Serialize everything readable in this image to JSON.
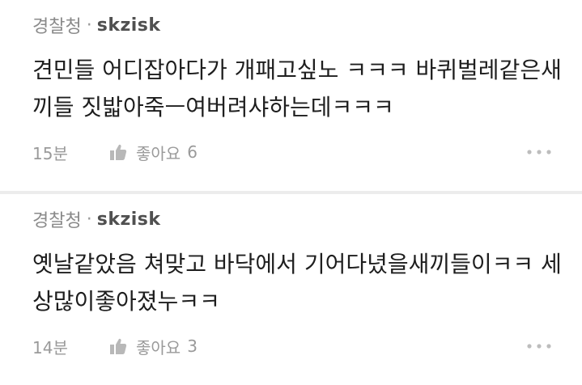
{
  "comments": [
    {
      "board": "경찰청",
      "separator": "·",
      "author": "skzisk",
      "lines": [
        "견민들 어디잡아다가 개패고싶노 ㅋㅋㅋ 바퀴벌레같은새",
        "끼들 짓밟아죽ㅡ여버려샤하는데ㅋㅋㅋ"
      ],
      "time": "15분",
      "like_label": "좋아요",
      "like_count": "6"
    },
    {
      "board": "경찰청",
      "separator": "·",
      "author": "skzisk",
      "lines": [
        "옛날같았음 쳐맞고 바닥에서 기어다녔을새끼들이ㅋㅋ 세",
        "상많이좋아졌누ㅋㅋ"
      ],
      "time": "14분",
      "like_label": "좋아요",
      "like_count": "3"
    }
  ],
  "icons": {
    "like": "thumbs-up-icon",
    "more": "more-horizontal-icon"
  },
  "colors": {
    "background": "#ffffff",
    "separator": "#ececec",
    "muted": "#9a9a9a",
    "text": "#1e1e1e"
  }
}
